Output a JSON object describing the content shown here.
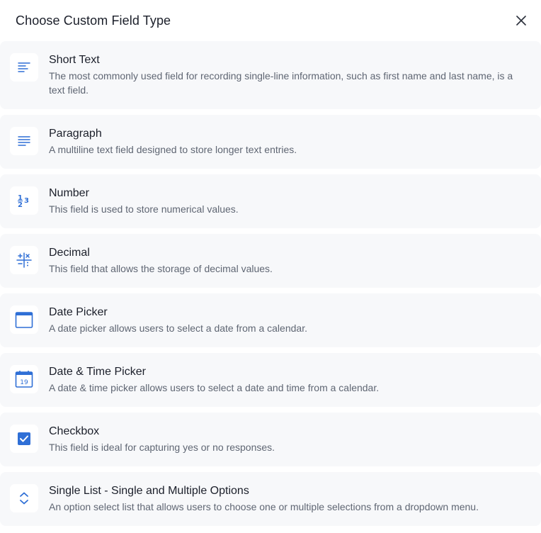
{
  "dialog": {
    "title": "Choose Custom Field Type",
    "close_icon": "close-icon",
    "accent_color": "#2f6fd6"
  },
  "field_types": [
    {
      "label": "Short Text",
      "description": "The most commonly used field for recording single-line information, such as first name and last name, is a text field.",
      "icon": "short-text-icon"
    },
    {
      "label": "Paragraph",
      "description": "A multiline text field designed to store longer text entries.",
      "icon": "paragraph-icon"
    },
    {
      "label": "Number",
      "description": "This field is used to store numerical values.",
      "icon": "number-icon"
    },
    {
      "label": "Decimal",
      "description": "This field that allows the storage of decimal values.",
      "icon": "decimal-icon"
    },
    {
      "label": "Date Picker",
      "description": "A date picker allows users to select a date from a calendar.",
      "icon": "calendar-icon"
    },
    {
      "label": "Date & Time Picker",
      "description": "A date & time picker allows users to select a date and time from a calendar.",
      "icon": "calendar-date-icon",
      "icon_text": "19"
    },
    {
      "label": "Checkbox",
      "description": "This field is ideal for capturing yes or no responses.",
      "icon": "checkbox-icon"
    },
    {
      "label": "Single List - Single and Multiple Options",
      "description": "An option select list that allows users to choose one or multiple selections from a dropdown menu.",
      "icon": "select-chevrons-icon"
    }
  ]
}
